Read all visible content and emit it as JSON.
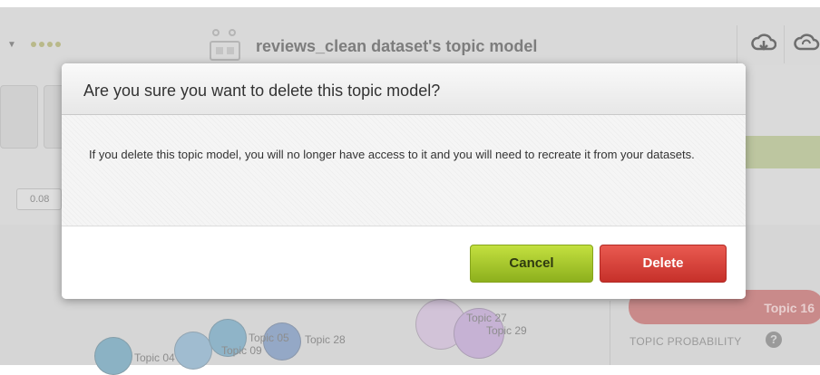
{
  "app": {
    "title": "reviews_clean dataset's topic model",
    "value_box": "0.08",
    "topics": [
      {
        "id": "04",
        "label": "Topic 04"
      },
      {
        "id": "09",
        "label": "Topic 09"
      },
      {
        "id": "05",
        "label": "Topic 05"
      },
      {
        "id": "28",
        "label": "Topic 28"
      },
      {
        "id": "27",
        "label": "Topic 27"
      },
      {
        "id": "29",
        "label": "Topic 29"
      }
    ],
    "selected_topic": "Topic 16",
    "topic_probability_label": "TOPIC PROBABILITY",
    "help_glyph": "?"
  },
  "modal": {
    "title": "Are you sure you want to delete this topic model?",
    "body": "If you delete this topic model, you will no longer have access to it and you will need to recreate it from your datasets.",
    "cancel_label": "Cancel",
    "delete_label": "Delete"
  },
  "colors": {
    "cancel_button": "#a6c92a",
    "delete_button": "#d9403a",
    "topic_pill": "#c98a8a"
  },
  "icons": [
    "chevron-down-icon",
    "model-icon",
    "cloud-download-icon",
    "cloud-refresh-icon",
    "help-icon"
  ]
}
